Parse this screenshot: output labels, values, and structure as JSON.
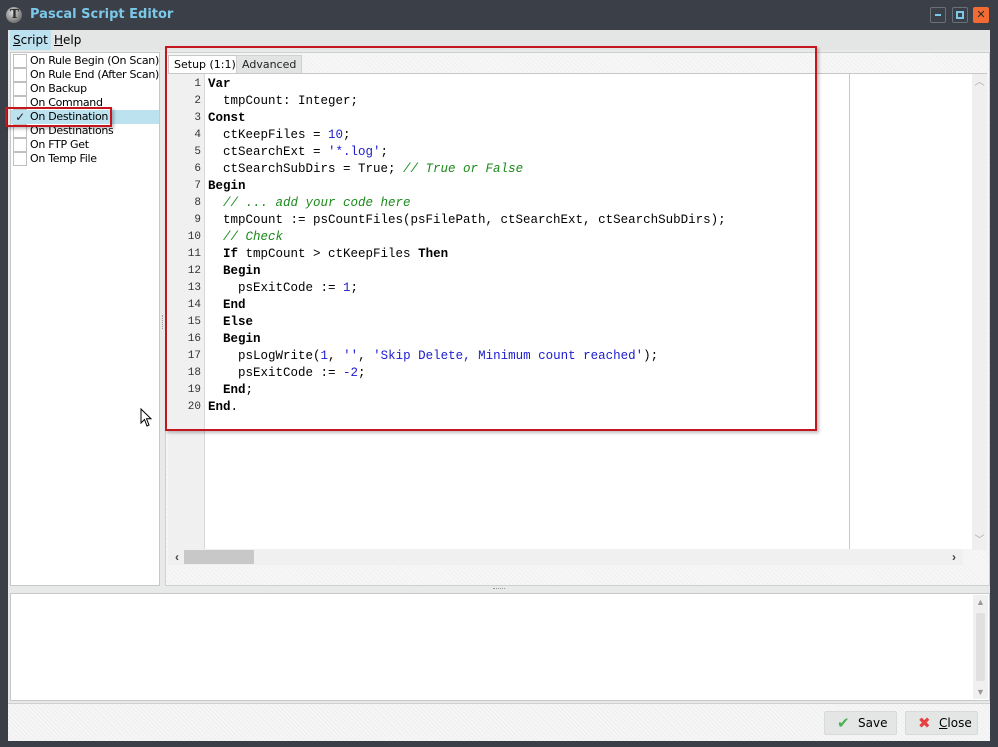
{
  "window": {
    "title": "Pascal Script Editor",
    "controls": {
      "minimize": "minimize",
      "maximize": "maximize",
      "close": "✕"
    }
  },
  "menu": {
    "items": [
      {
        "label": "Script",
        "accel": "S",
        "rest": "cript"
      },
      {
        "label": "Help",
        "accel": "H",
        "rest": "elp"
      }
    ]
  },
  "events": {
    "items": [
      {
        "label": "On Rule Begin (On Scan)",
        "checked": false
      },
      {
        "label": "On Rule End (After Scan)",
        "checked": false
      },
      {
        "label": "On Backup",
        "checked": false
      },
      {
        "label": "On Command",
        "checked": false
      },
      {
        "label": "On Destination",
        "checked": true,
        "selected": true
      },
      {
        "label": "On Destinations",
        "checked": false
      },
      {
        "label": "On FTP Get",
        "checked": false
      },
      {
        "label": "On Temp File",
        "checked": false
      }
    ],
    "check_glyph": "✓"
  },
  "editor": {
    "tabs": [
      {
        "label": "Setup (1:1)",
        "active": true
      },
      {
        "label": "Advanced",
        "active": false
      }
    ],
    "lines": [
      {
        "n": "1",
        "html": "<span class='kw'>Var</span>"
      },
      {
        "n": "2",
        "html": "  tmpCount: Integer;"
      },
      {
        "n": "3",
        "html": "<span class='kw'>Const</span>"
      },
      {
        "n": "4",
        "html": "  ctKeepFiles = <span class='num'>10</span>;"
      },
      {
        "n": "5",
        "html": "  ctSearchExt = <span class='str'>'*.log'</span>;"
      },
      {
        "n": "6",
        "html": "  ctSearchSubDirs = True; <span class='cmt'>// True or False</span>"
      },
      {
        "n": "7",
        "html": "<span class='kw'>Begin</span>"
      },
      {
        "n": "8",
        "html": "  <span class='cmt'>// ... add your code here</span>"
      },
      {
        "n": "9",
        "html": "  tmpCount := psCountFiles(psFilePath, ctSearchExt, ctSearchSubDirs);"
      },
      {
        "n": "10",
        "html": "  <span class='cmt'>// Check</span>"
      },
      {
        "n": "11",
        "html": "  <span class='kw'>If</span> tmpCount > ctKeepFiles <span class='kw'>Then</span>"
      },
      {
        "n": "12",
        "html": "  <span class='kw'>Begin</span>"
      },
      {
        "n": "13",
        "html": "    psExitCode := <span class='num'>1</span>;"
      },
      {
        "n": "14",
        "html": "  <span class='kw'>End</span>"
      },
      {
        "n": "15",
        "html": "  <span class='kw'>Else</span>"
      },
      {
        "n": "16",
        "html": "  <span class='kw'>Begin</span>"
      },
      {
        "n": "17",
        "html": "    psLogWrite(<span class='num'>1</span>, <span class='str'>''</span>, <span class='str'>'Skip Delete, Minimum count reached'</span>);"
      },
      {
        "n": "18",
        "html": "    psExitCode := <span class='num'>-2</span>;"
      },
      {
        "n": "19",
        "html": "  <span class='kw'>End</span>;"
      },
      {
        "n": "20",
        "html": "<span class='kw'>End</span>."
      }
    ]
  },
  "output": {
    "text": ""
  },
  "footer": {
    "save": {
      "label": "Save",
      "icon": "✔"
    },
    "close": {
      "label": "Close",
      "accel": "C",
      "rest": "lose",
      "icon": "✖"
    }
  },
  "colors": {
    "title_text": "#7cc8e8",
    "titlebar_bg": "#3a3f48",
    "close_button": "#f26b32",
    "selection_bg": "#bce2f0",
    "highlight_border": "#c4161c",
    "keyword": "#000000",
    "number_string": "#1c1ccc",
    "comment": "#1a8a1a"
  }
}
